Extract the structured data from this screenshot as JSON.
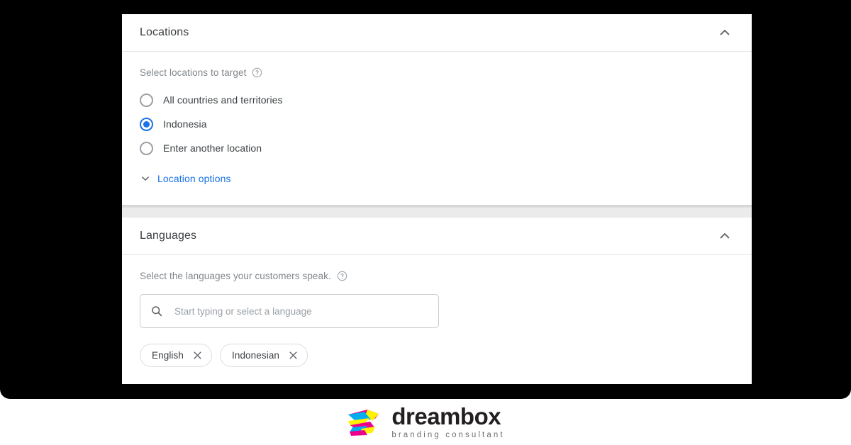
{
  "theme": {
    "accent_blue": "#1a73e8",
    "text_primary": "#3c4043",
    "text_secondary": "#80868b",
    "border": "#dadce0",
    "backdrop": "#000000",
    "panel_bg": "#ffffff",
    "strip_bg": "#ebebeb"
  },
  "locations": {
    "title": "Locations",
    "collapse_toggle": "collapse",
    "prompt": "Select locations to target",
    "help_tooltip": "?",
    "options": [
      {
        "label": "All countries and territories",
        "selected": false
      },
      {
        "label": "Indonesia",
        "selected": true
      },
      {
        "label": "Enter another location",
        "selected": false
      }
    ],
    "options_link": "Location options"
  },
  "languages": {
    "title": "Languages",
    "collapse_toggle": "collapse",
    "prompt": "Select the languages your customers speak.",
    "help_tooltip": "?",
    "search": {
      "placeholder": "Start typing or select a language",
      "value": ""
    },
    "selected_chips": [
      {
        "label": "English",
        "remove": "×"
      },
      {
        "label": "Indonesian",
        "remove": "×"
      }
    ]
  },
  "footer": {
    "brand_name": "dreambox",
    "brand_tagline": "branding consultant"
  }
}
